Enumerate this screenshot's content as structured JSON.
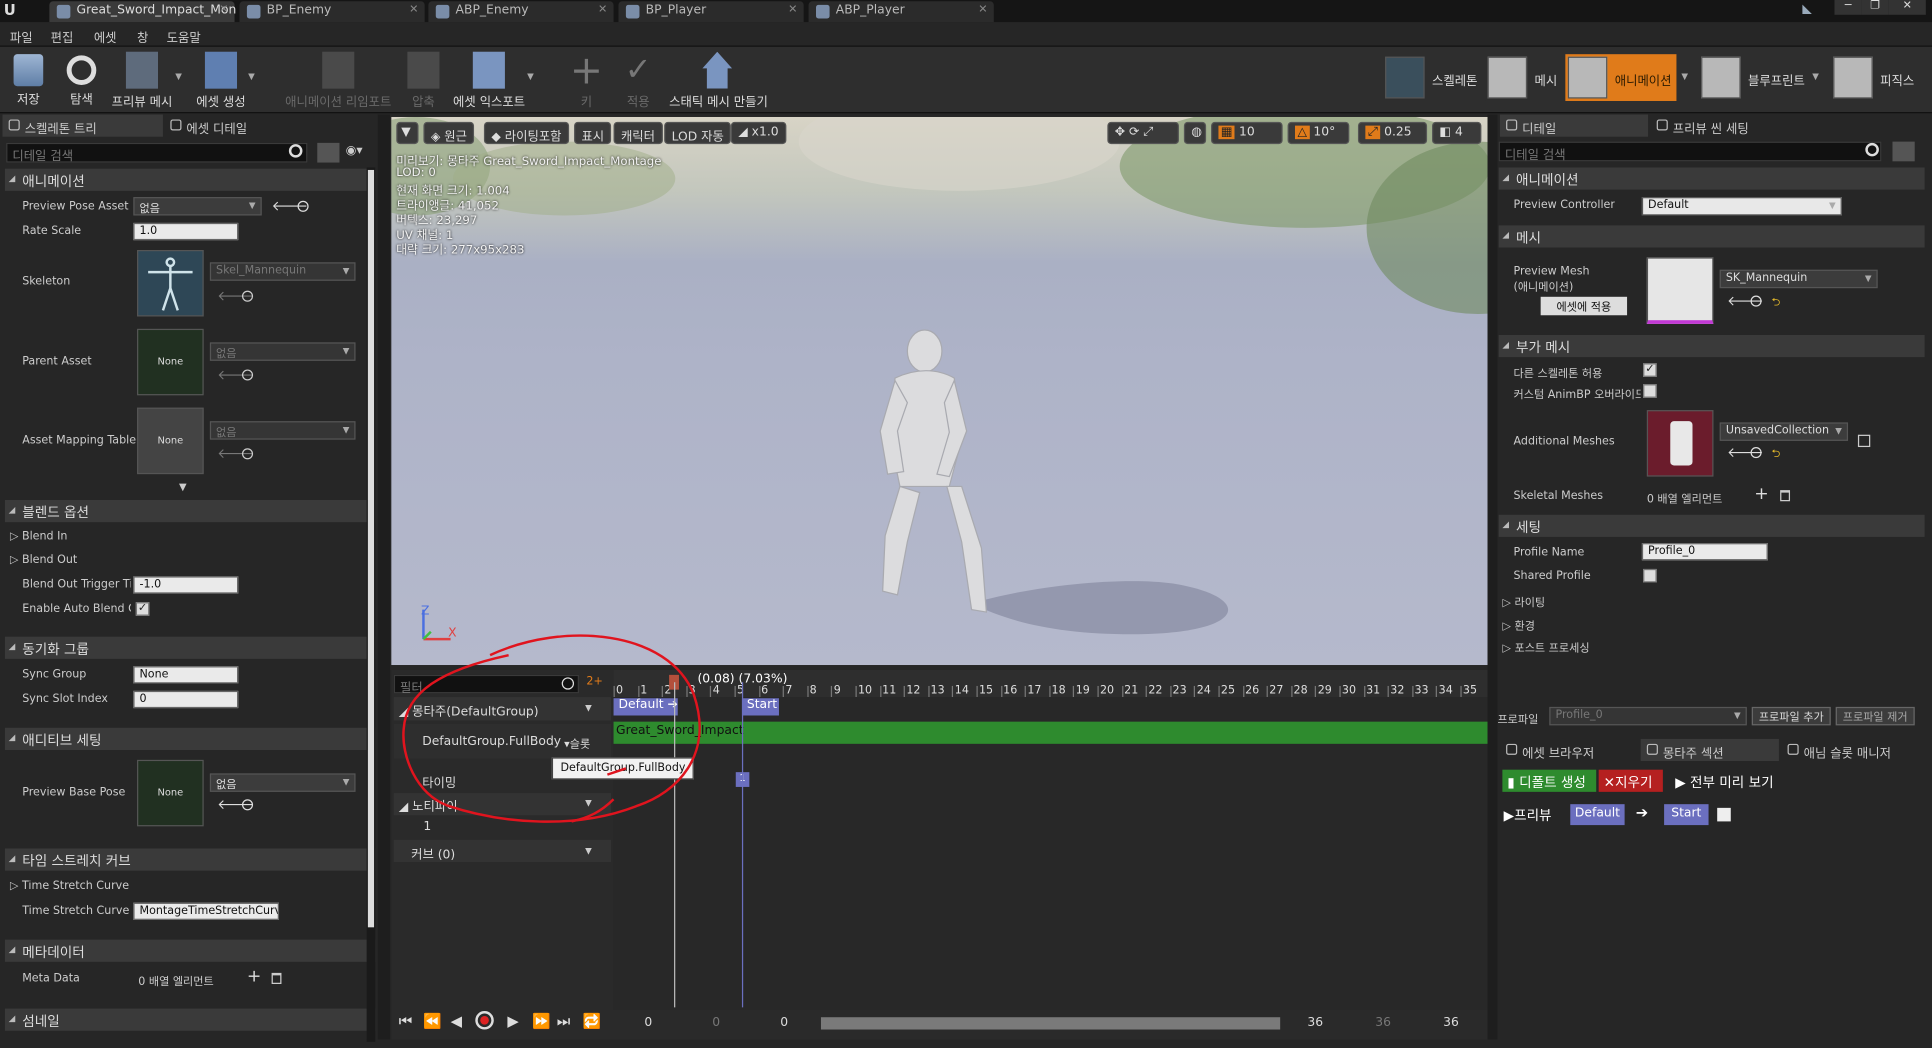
{
  "tabs": [
    {
      "label": "Great_Sword_Impact_Mon"
    },
    {
      "label": "BP_Enemy"
    },
    {
      "label": "ABP_Enemy"
    },
    {
      "label": "BP_Player"
    },
    {
      "label": "ABP_Player"
    }
  ],
  "menu": [
    "파일",
    "편집",
    "에셋",
    "창",
    "도움말"
  ],
  "toolbar": {
    "save": "저장",
    "browse": "탐색",
    "preview_mesh": "프리뷰 메시",
    "create_asset": "에셋 생성",
    "reimport": "애니메이션 리임포트",
    "compress": "압축",
    "export_asset": "에셋 익스포트",
    "key": "키",
    "apply": "적용",
    "make_static_mesh": "스태틱 메시 만들기"
  },
  "modes": {
    "skeleton": "스켈레톤",
    "mesh": "메시",
    "animation": "애니메이션",
    "blueprint": "블루프린트",
    "physics": "피직스"
  },
  "left": {
    "tabs": [
      "스켈레톤 트리",
      "에셋 디테일"
    ],
    "search_placeholder": "디테일 검색",
    "cat_animation": "애니메이션",
    "preview_pose_asset": "Preview Pose Asset",
    "preview_pose_val": "없음",
    "rate_scale": "Rate Scale",
    "rate_scale_val": "1.0",
    "skeleton": "Skeleton",
    "skeleton_val": "Skel_Mannequin",
    "parent_asset": "Parent Asset",
    "parent_val": "없음",
    "asset_mapping": "Asset Mapping Table",
    "asset_mapping_val": "없음",
    "none": "None",
    "cat_blend": "블렌드 옵션",
    "blend_in": "Blend In",
    "blend_out": "Blend Out",
    "blend_out_trigger": "Blend Out Trigger Tim",
    "blend_out_trigger_val": "-1.0",
    "enable_auto": "Enable Auto Blend Ou",
    "cat_sync": "동기화 그룹",
    "sync_group": "Sync Group",
    "sync_group_val": "None",
    "sync_slot": "Sync Slot Index",
    "sync_slot_val": "0",
    "cat_additive": "애디티브 세팅",
    "preview_base_pose": "Preview Base Pose",
    "preview_base_val": "없음",
    "cat_timestretch": "타임 스트레치 커브",
    "ts_curve": "Time Stretch Curve",
    "ts_curve_n": "Time Stretch Curve N",
    "ts_curve_n_val": "MontageTimeStretchCurve",
    "cat_meta": "메타데이터",
    "meta_data": "Meta Data",
    "meta_val": "0 배열 엘리먼트",
    "cat_thumb": "섬네일"
  },
  "viewport": {
    "buttons": {
      "perspective": "원근",
      "lighting": "라이팅포함",
      "show": "표시",
      "character": "캐릭터",
      "lod": "LOD 자동",
      "speed": "x1.0",
      "grid": "10",
      "angle": "10°",
      "scale": "0.25",
      "cam": "4"
    },
    "info": [
      "미리보기: 몽타주 Great_Sword_Impact_Montage",
      "LOD: 0",
      "현재 화면 크기: 1.004",
      "트라이앵글: 41,052",
      "버텍스: 23,297",
      "UV 채널: 1",
      "대략 크기: 277x95x283"
    ],
    "axis_z": "Z",
    "axis_x": "X"
  },
  "sequencer": {
    "filter_placeholder": "필터",
    "time_readout": "(0.08) (7.03%)",
    "montage_row": "몽타주(DefaultGroup)",
    "slot_row": "DefaultGroup.FullBody",
    "slot_btn": "슬롯",
    "timing_row": "타이밍",
    "notify_row": "노티파이",
    "notify_track": "1",
    "curve_row": "커브  (0)",
    "section_default": "Default",
    "section_start": "Start",
    "clip_name": "Great_Sword_Impact",
    "tooltip": "DefaultGroup.FullBody",
    "timing_marker": "1",
    "ticks": [
      "0",
      "1",
      "2",
      "3",
      "4",
      "5",
      "6",
      "7",
      "8",
      "9",
      "10",
      "11",
      "12",
      "13",
      "14",
      "15",
      "16",
      "17",
      "18",
      "19",
      "20",
      "21",
      "22",
      "23",
      "24",
      "25",
      "26",
      "27",
      "28",
      "29",
      "30",
      "31",
      "32",
      "33",
      "34",
      "35"
    ],
    "range": {
      "a": "0",
      "b": "0",
      "c": "0",
      "d": "36",
      "e": "36",
      "f": "36"
    }
  },
  "right": {
    "tabs": [
      "디테일",
      "프리뷰 씬 세팅"
    ],
    "search_placeholder": "디테일 검색",
    "cat_animation": "애니메이션",
    "preview_controller": "Preview Controller",
    "preview_controller_val": "Default",
    "cat_mesh": "메시",
    "preview_mesh": "Preview Mesh",
    "preview_mesh_sub": "(애니메이션)",
    "preview_mesh_val": "SK_Mannequin",
    "apply_to_asset": "에셋에 적용",
    "cat_addmesh": "부가 메시",
    "allow_diff_skel": "다른 스켈레톤 허용",
    "custom_animbp": "커스텀 AnimBP 오버라이드",
    "additional_meshes": "Additional Meshes",
    "additional_val": "UnsavedCollection",
    "skeletal_meshes": "Skeletal Meshes",
    "skeletal_val": "0 배열 엘리먼트",
    "cat_settings": "세팅",
    "profile_name": "Profile Name",
    "profile_name_val": "Profile_0",
    "shared_profile": "Shared Profile",
    "lighting": "라이팅",
    "environment": "환경",
    "post_process": "포스트 프로세싱",
    "profile_label": "프로파일",
    "profile_val": "Profile_0",
    "profile_add": "프로파일 추가",
    "profile_remove": "프로파일 제거"
  },
  "bottom_right": {
    "tabs": [
      "에셋 브라우저",
      "몽타주 섹션",
      "애님 슬롯 매니저"
    ],
    "create_default": "디폴트 생성",
    "clear": "지우기",
    "preview_all": "전부 미리 보기",
    "preview": "프리뷰",
    "default": "Default",
    "start": "Start"
  },
  "colors": {
    "accent": "#e07b1a",
    "green": "#2e8b2e",
    "section": "#6b6fbf",
    "annotation": "#e0141e"
  }
}
